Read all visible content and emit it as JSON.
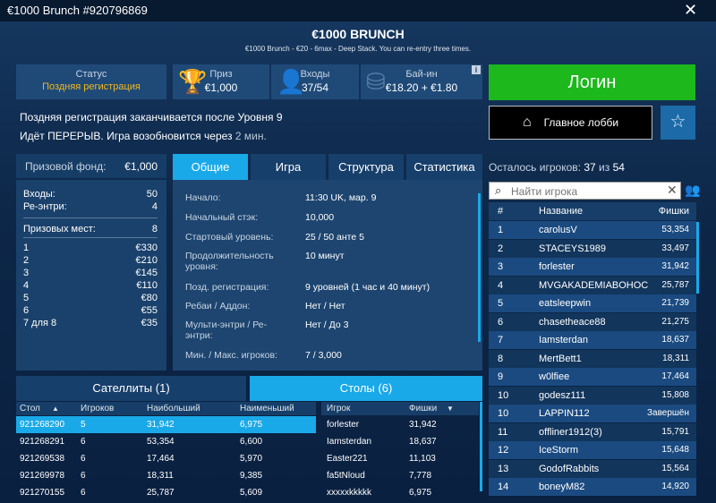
{
  "window": {
    "title": "€1000 Brunch #920796869"
  },
  "header": {
    "title": "€1000 BRUNCH",
    "subtitle": "€1000 Brunch - €20 - 6max - Deep Stack. You can re-entry three times."
  },
  "stats": {
    "status": {
      "label": "Статус",
      "value": "Поздняя регистрация"
    },
    "prize": {
      "label": "Приз",
      "value": "€1,000"
    },
    "entries": {
      "label": "Входы",
      "value": "37/54"
    },
    "buyin": {
      "label": "Бай-ин",
      "value": "€18.20 + €1.80"
    }
  },
  "info_icon": "i",
  "buttons": {
    "login": "Логин",
    "lobby": "Главное лобби"
  },
  "notices": {
    "line1": "Поздняя регистрация заканчивается после Уровня 9",
    "line2": "Идёт ПЕРЕРЫВ. Игра возобновится через",
    "line2_time": "2 мин."
  },
  "prizepool": {
    "label": "Призовой фонд:",
    "value": "€1,000",
    "entries_label": "Входы:",
    "entries": "50",
    "reentries_label": "Ре-энтри:",
    "reentries": "4",
    "places_label": "Призовых мест:",
    "places": "8",
    "payouts": [
      [
        "1",
        "€330"
      ],
      [
        "2",
        "€210"
      ],
      [
        "3",
        "€145"
      ],
      [
        "4",
        "€110"
      ],
      [
        "5",
        "€80"
      ],
      [
        "6",
        "€55"
      ],
      [
        "7 для 8",
        "€35"
      ]
    ]
  },
  "tabs": [
    "Общие",
    "Игра",
    "Структура",
    "Статистика"
  ],
  "info": [
    {
      "k": "Начало:",
      "v": "11:30 UK, мар. 9"
    },
    {
      "k": "Начальный стэк:",
      "v": "10,000"
    },
    {
      "k": "Стартовый уровень:",
      "v": "25 / 50 анте 5"
    },
    {
      "k": "Продолжительность уровня:",
      "v": "10 минут"
    },
    {
      "k": "Позд. регистрация:",
      "v": "9 уровней (1 час и 40 минут)"
    },
    {
      "k": "Ребаи / Аддон:",
      "v": "Нет / Нет"
    },
    {
      "k": "Мульти-энтри / Ре-энтри:",
      "v": "Нет / До 3"
    },
    {
      "k": "Мин. / Макс. игроков:",
      "v": "7 / 3,000"
    }
  ],
  "bottom_tabs": {
    "satellites": "Сателлиты (1)",
    "tables": "Столы (6)"
  },
  "tables": {
    "headers": [
      "Стол",
      "Игроков",
      "Наибольший",
      "Наименьший"
    ],
    "sort_icon": "▲",
    "rows": [
      [
        "921268290",
        "5",
        "31,942",
        "6,975"
      ],
      [
        "921268291",
        "6",
        "53,354",
        "6,600"
      ],
      [
        "921269538",
        "6",
        "17,464",
        "5,970"
      ],
      [
        "921269978",
        "6",
        "18,311",
        "9,385"
      ],
      [
        "921270155",
        "6",
        "25,787",
        "5,609"
      ]
    ]
  },
  "table_players": {
    "headers": [
      "Игрок",
      "Фишки"
    ],
    "sort_icon": "▼",
    "rows": [
      [
        "forlester",
        "31,942"
      ],
      [
        "Iamsterdan",
        "18,637"
      ],
      [
        "Easter221",
        "11,103"
      ],
      [
        "fa5tNloud",
        "7,778"
      ],
      [
        "xxxxxkkkkk",
        "6,975"
      ]
    ]
  },
  "players": {
    "remaining_label": "Осталось игроков:",
    "remaining": "37",
    "of": "из",
    "total": "54",
    "search_placeholder": "Найти игрока",
    "headers": [
      "#",
      "Название",
      "Фишки"
    ],
    "rows": [
      [
        "1",
        "carolusV",
        "53,354"
      ],
      [
        "2",
        "STACEYS1989",
        "33,497"
      ],
      [
        "3",
        "forlester",
        "31,942"
      ],
      [
        "4",
        "MVGAKADEMIABOHOC",
        "25,787"
      ],
      [
        "5",
        "eatsleepwin",
        "21,739"
      ],
      [
        "6",
        "chasetheace88",
        "21,275"
      ],
      [
        "7",
        "Iamsterdan",
        "18,637"
      ],
      [
        "8",
        "MertBett1",
        "18,311"
      ],
      [
        "9",
        "w0lfiee",
        "17,464"
      ],
      [
        "10",
        "godesz111",
        "15,808"
      ],
      [
        "10",
        "LAPPIN112",
        "Завершён"
      ],
      [
        "11",
        "offliner1912(3)",
        "15,791"
      ],
      [
        "12",
        "IceStorm",
        "15,648"
      ],
      [
        "13",
        "GodofRabbits",
        "15,564"
      ],
      [
        "14",
        "boneyM82",
        "14,920"
      ]
    ]
  }
}
